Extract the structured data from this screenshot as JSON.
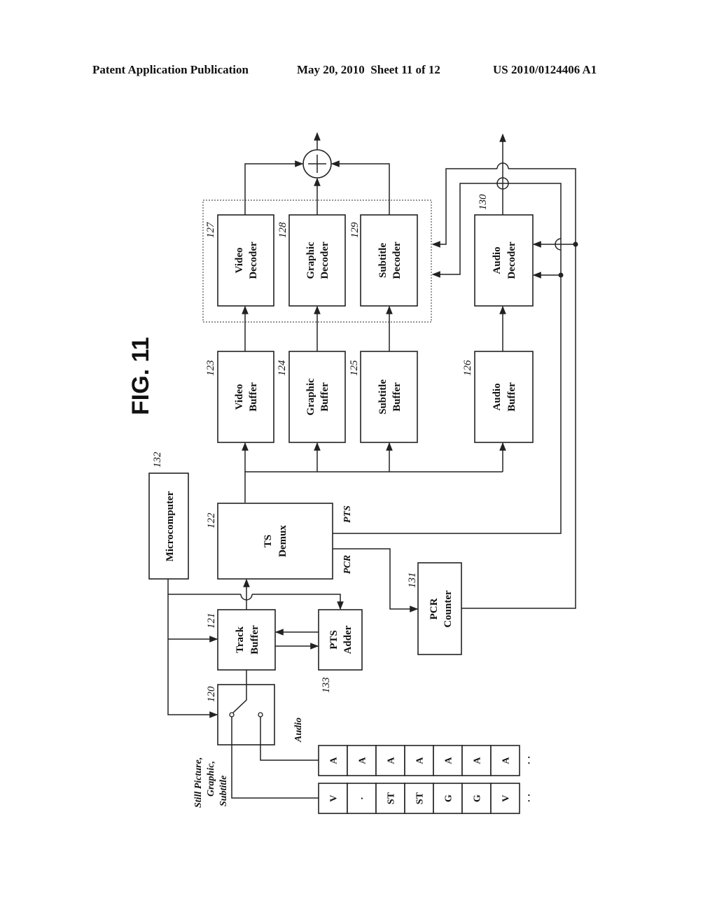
{
  "header": {
    "publication": "Patent Application Publication",
    "date_sheet": "May 20, 2010  Sheet 11 of 12",
    "number": "US 2010/0124406 A1"
  },
  "figure": {
    "title": "FIG. 11",
    "blocks": {
      "switch": {
        "ref": "120"
      },
      "track_buffer": {
        "ref": "121",
        "line1": "Track",
        "line2": "Buffer"
      },
      "ts_demux": {
        "ref": "122",
        "line1": "TS",
        "line2": "Demux"
      },
      "video_buffer": {
        "ref": "123",
        "line1": "Video",
        "line2": "Buffer"
      },
      "graphic_buffer": {
        "ref": "124",
        "line1": "Graphic",
        "line2": "Buffer"
      },
      "subtitle_buffer": {
        "ref": "125",
        "line1": "Subtitle",
        "line2": "Buffer"
      },
      "audio_buffer": {
        "ref": "126",
        "line1": "Audio",
        "line2": "Buffer"
      },
      "video_decoder": {
        "ref": "127",
        "line1": "Video",
        "line2": "Decoder"
      },
      "graphic_decoder": {
        "ref": "128",
        "line1": "Graphic",
        "line2": "Decoder"
      },
      "subtitle_decoder": {
        "ref": "129",
        "line1": "Subtitle",
        "line2": "Decoder"
      },
      "audio_decoder": {
        "ref": "130",
        "line1": "Audio",
        "line2": "Decoder"
      },
      "pcr_counter": {
        "ref": "131",
        "line1": "PCR",
        "line2": "Counter"
      },
      "microcomputer": {
        "ref": "132",
        "line1": "Microcomputer"
      },
      "pts_adder": {
        "ref": "133",
        "line1": "PTS",
        "line2": "Adder"
      }
    },
    "signals": {
      "pts": "PTS",
      "pcr": "PCR",
      "audio_input": "Audio",
      "still_input_1": "Still Picture,",
      "still_input_2": "Graphic,",
      "still_input_3": "Subtitle"
    },
    "streams": {
      "audio_row": [
        "A",
        "A",
        "A",
        "A",
        "A",
        "A",
        "A"
      ],
      "video_row": [
        "V",
        "·",
        "ST",
        "ST",
        "G",
        "G",
        "V"
      ],
      "continuation": "· ·"
    },
    "adder_symbol": "+"
  }
}
